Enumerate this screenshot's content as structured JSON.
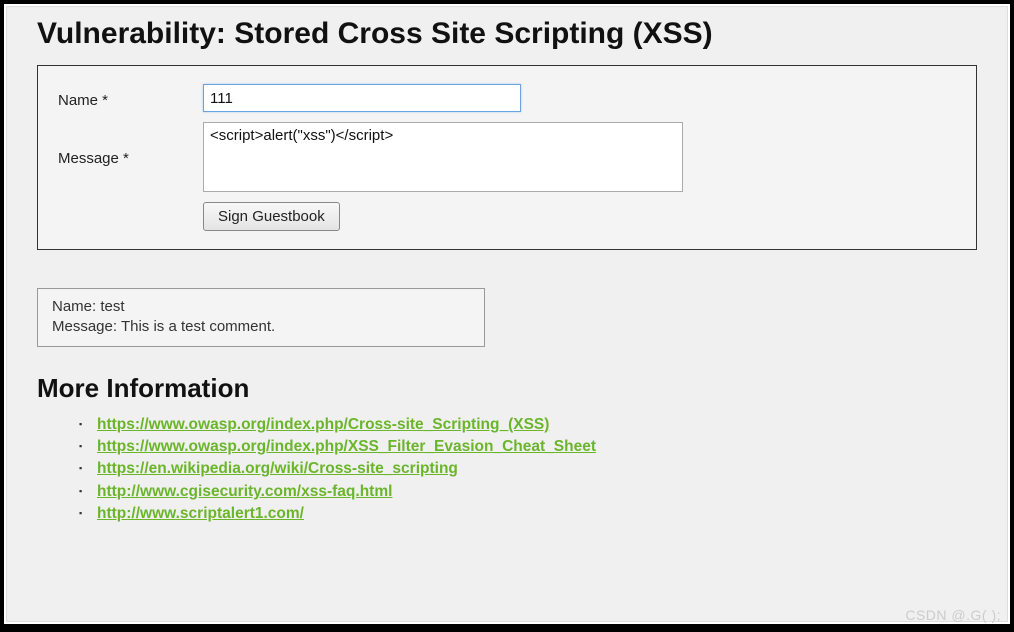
{
  "page_title": "Vulnerability: Stored Cross Site Scripting (XSS)",
  "form": {
    "name_label": "Name *",
    "name_value": "111",
    "message_label": "Message *",
    "message_value": "<script>alert(\"xss\")</script>",
    "submit_label": "Sign Guestbook"
  },
  "guestbook_entry": {
    "name_label": "Name:",
    "name_value": "test",
    "message_label": "Message:",
    "message_value": "This is a test comment."
  },
  "more_info": {
    "heading": "More Information",
    "links": [
      "https://www.owasp.org/index.php/Cross-site_Scripting_(XSS)",
      "https://www.owasp.org/index.php/XSS_Filter_Evasion_Cheat_Sheet",
      "https://en.wikipedia.org/wiki/Cross-site_scripting",
      "http://www.cgisecurity.com/xss-faq.html",
      "http://www.scriptalert1.com/"
    ]
  },
  "watermark": "CSDN @.G( );"
}
